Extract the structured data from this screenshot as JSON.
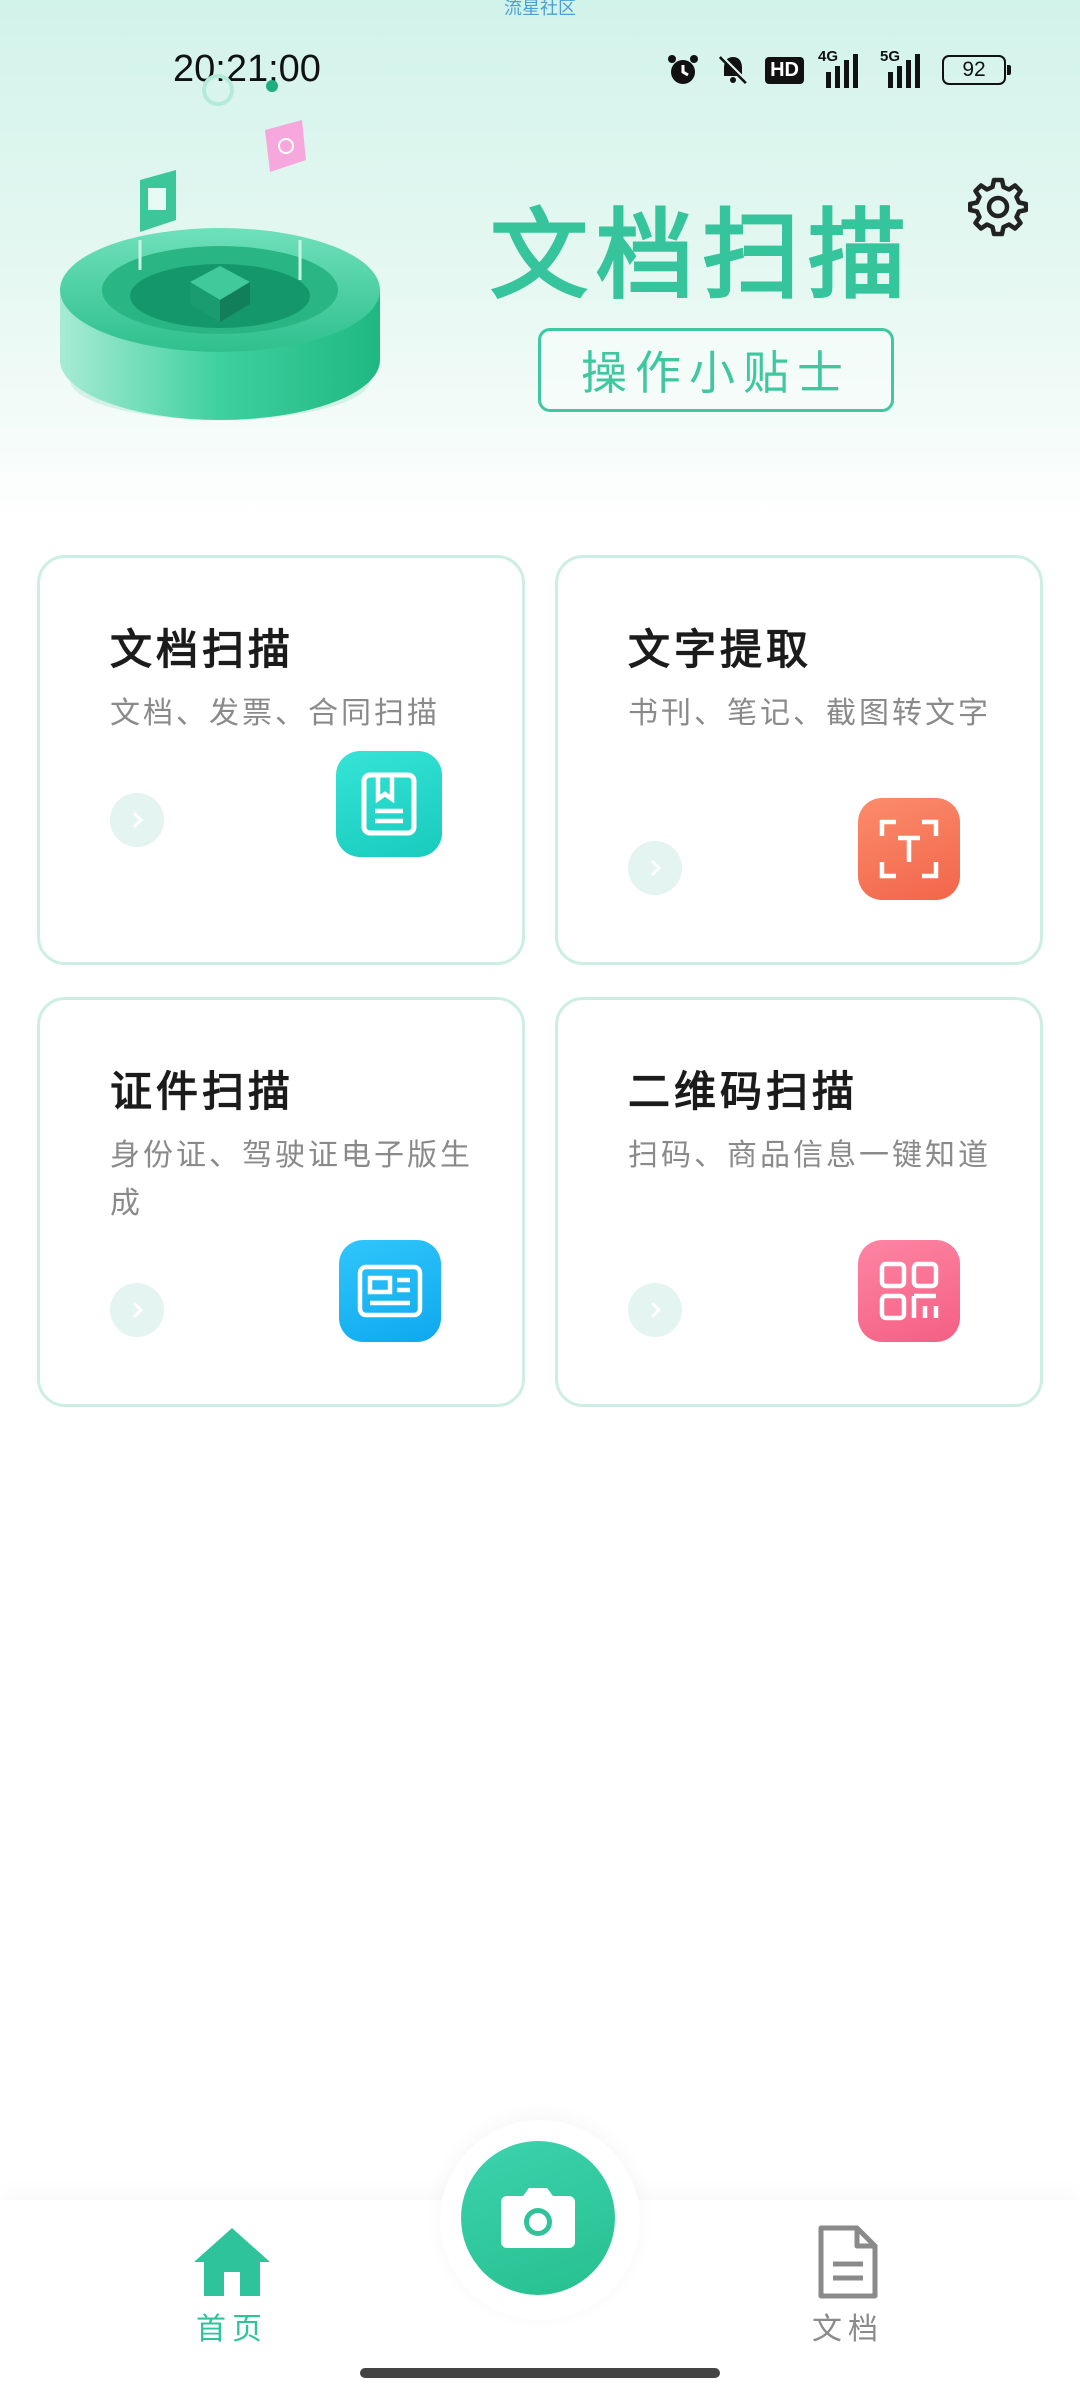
{
  "watermark": "流星社区",
  "status_bar": {
    "time": "20:21:00",
    "hd_label": "HD",
    "net1_label": "4G",
    "net2_label": "5G",
    "battery_level": "92",
    "icons": [
      "alarm-icon",
      "bell-muted-icon",
      "hd-icon",
      "signal-4g-icon",
      "signal-5g-icon",
      "battery-icon"
    ]
  },
  "header": {
    "title": "文档扫描",
    "tips_button": "操作小贴士",
    "settings_icon": "gear-icon"
  },
  "cards": [
    {
      "title": "文档扫描",
      "desc": "文档、发票、合同扫描",
      "icon": "document-icon",
      "color": "#20d7c8"
    },
    {
      "title": "文字提取",
      "desc": "书刊、笔记、截图转文字",
      "icon": "text-scan-icon",
      "color": "#f7795d"
    },
    {
      "title": "证件扫描",
      "desc": "身份证、驾驶证电子版生成",
      "icon": "id-card-icon",
      "color": "#1ab8f5"
    },
    {
      "title": "二维码扫描",
      "desc": "扫码、商品信息一键知道",
      "icon": "qr-code-icon",
      "color": "#fb7094"
    }
  ],
  "bottom_nav": {
    "home_label": "首页",
    "docs_label": "文档",
    "active_color": "#2fc39c",
    "inactive_color": "#8a8a8a"
  }
}
